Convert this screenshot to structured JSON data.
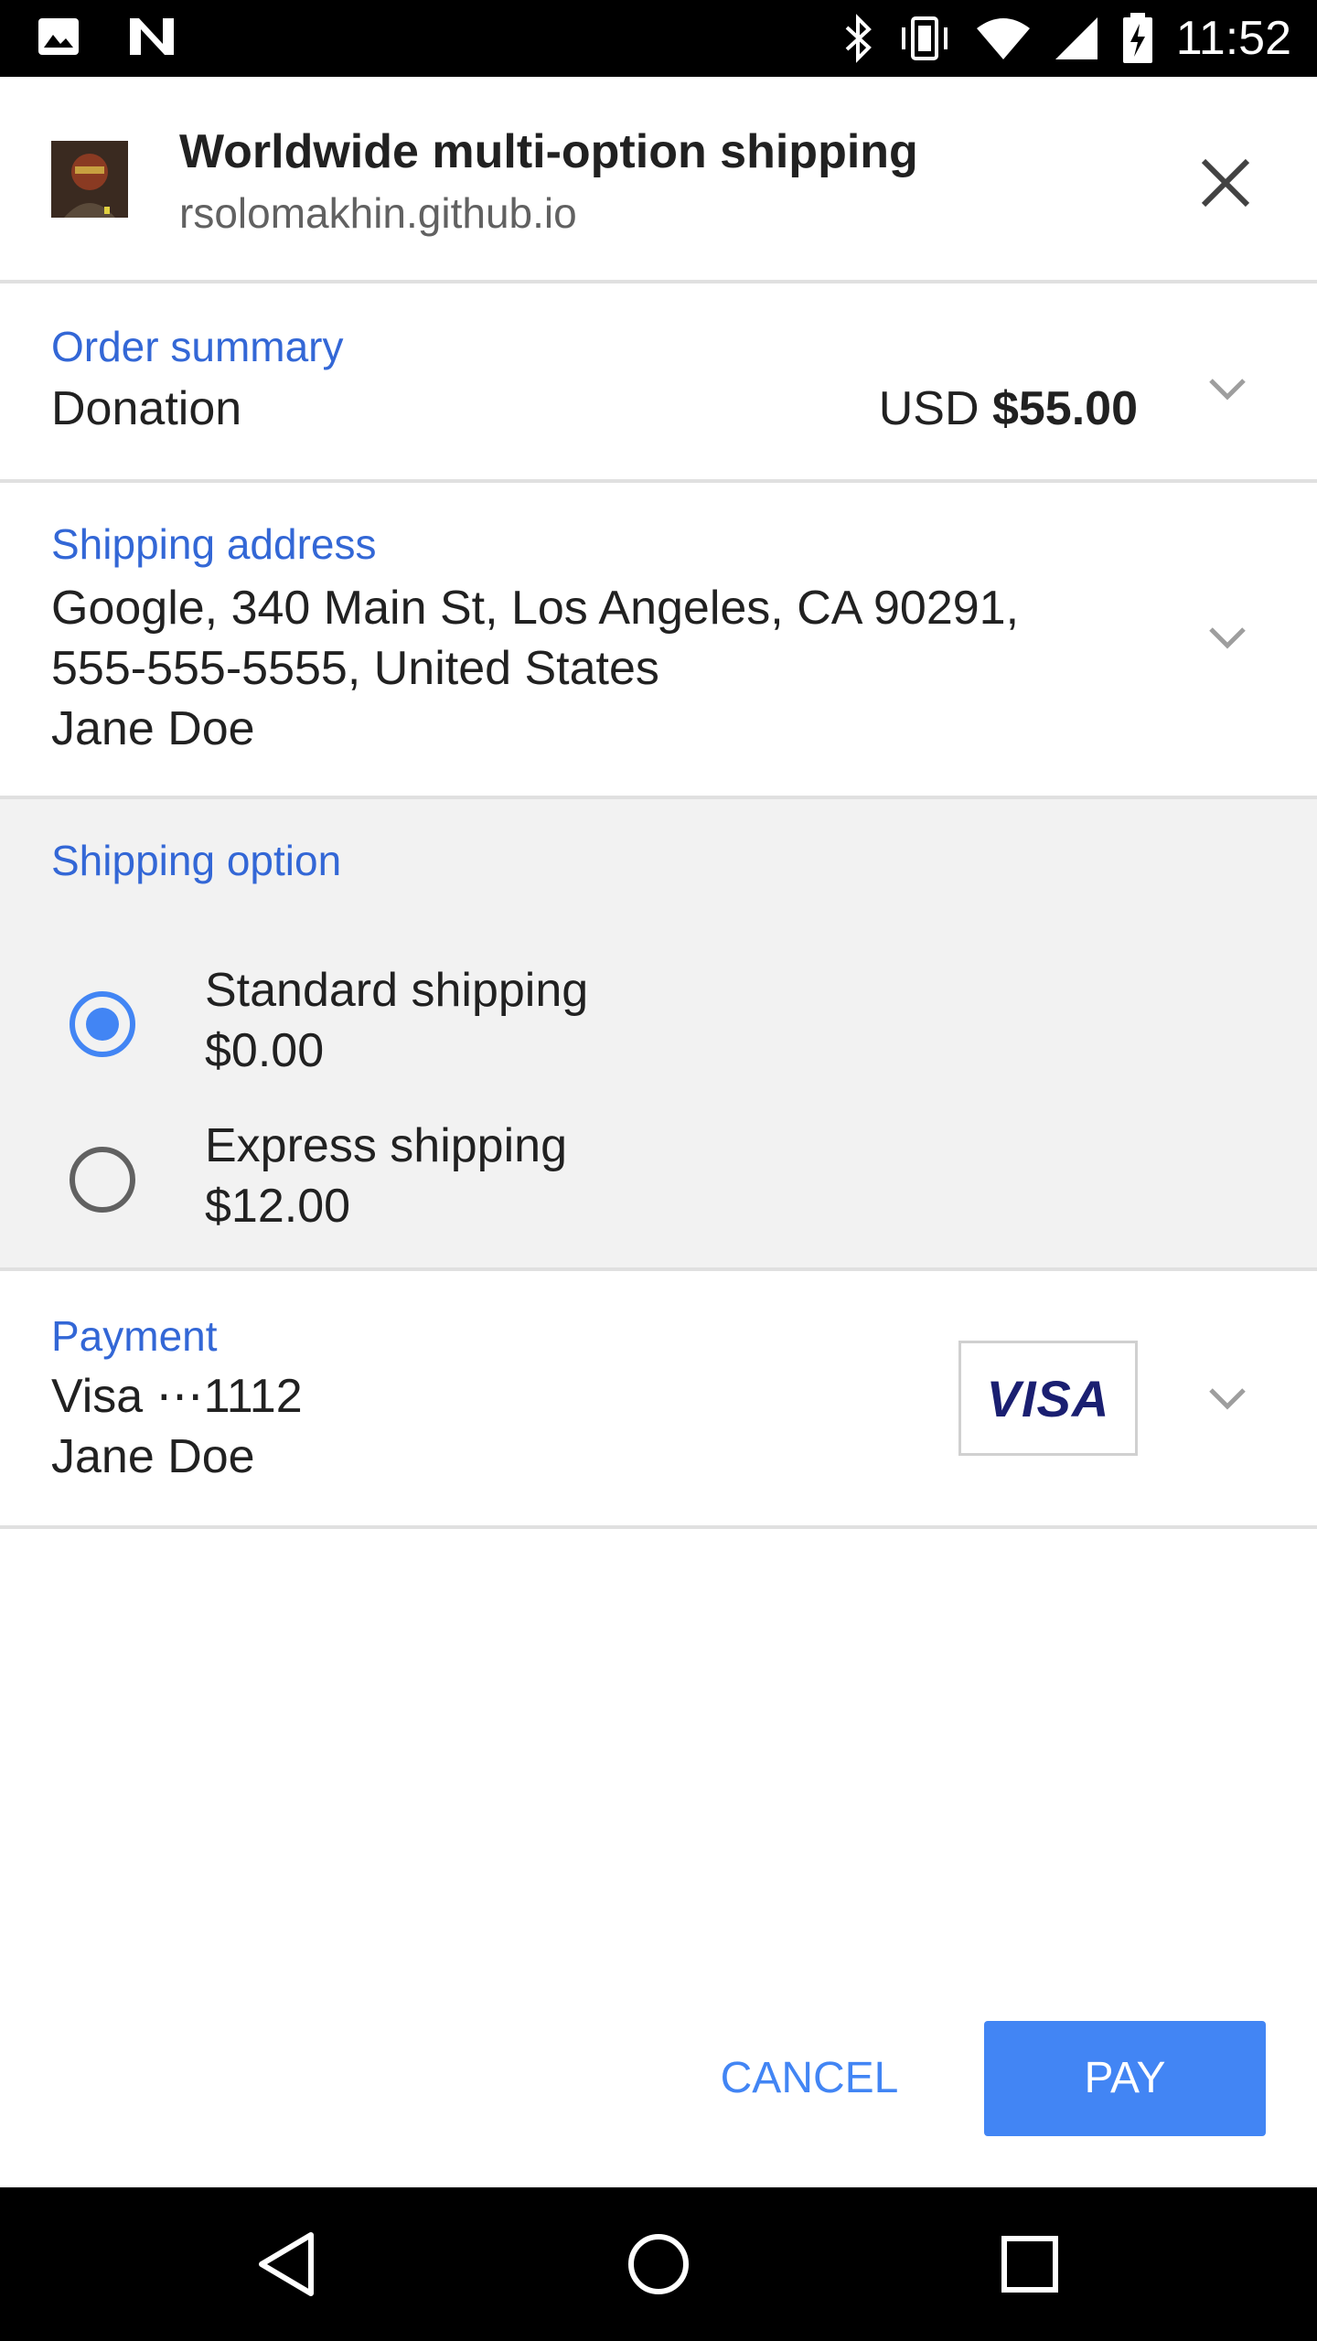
{
  "status_bar": {
    "time": "11:52",
    "left_icons": [
      "image-icon",
      "n-logo-icon"
    ],
    "right_icons": [
      "bluetooth-icon",
      "vibrate-icon",
      "wifi-icon",
      "signal-icon",
      "battery-charging-icon"
    ]
  },
  "header": {
    "title": "Worldwide multi-option shipping",
    "origin": "rsolomakhin.github.io",
    "favicon": "site-favicon",
    "close_icon": "close-icon"
  },
  "order_summary": {
    "label": "Order summary",
    "item": "Donation",
    "currency": "USD",
    "amount": "$55.00"
  },
  "shipping_address": {
    "label": "Shipping address",
    "line1": "Google, 340 Main St, Los Angeles, CA 90291,",
    "line2": "555-555-5555, United States",
    "line3": "Jane Doe"
  },
  "shipping_option": {
    "label": "Shipping option",
    "options": [
      {
        "name": "Standard shipping",
        "price": "$0.00",
        "selected": true
      },
      {
        "name": "Express shipping",
        "price": "$12.00",
        "selected": false
      }
    ]
  },
  "payment": {
    "label": "Payment",
    "card": "Visa ⋯1112",
    "holder": "Jane Doe",
    "brand": "VISA"
  },
  "actions": {
    "cancel_label": "CANCEL",
    "pay_label": "PAY"
  },
  "colors": {
    "accent": "#4285f4",
    "label_blue": "#3367d6",
    "selected_bg": "#f2f2f2",
    "visa_blue": "#1a1f71"
  },
  "nav_bar": {
    "buttons": [
      "back-icon",
      "home-icon",
      "recents-icon"
    ]
  }
}
